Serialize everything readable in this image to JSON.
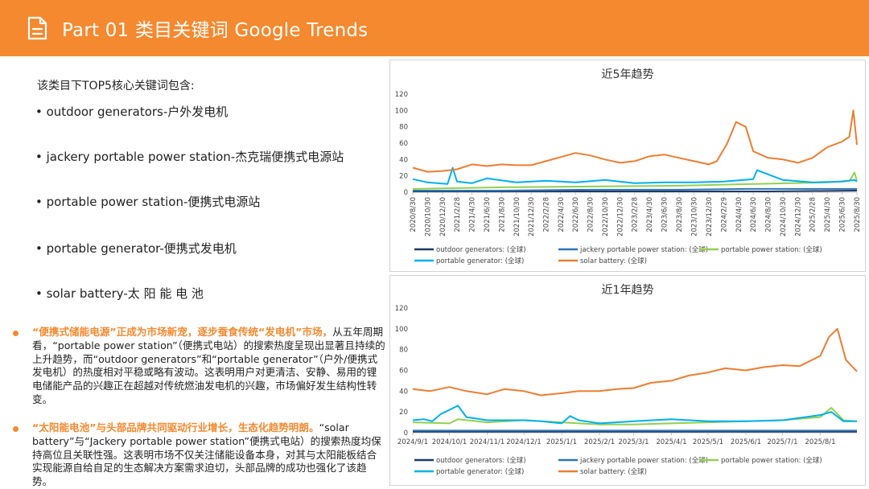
{
  "header": {
    "title": "Part 01 类目关键词 Google Trends",
    "icon": "document-icon",
    "color": "#f4892f"
  },
  "intro": "该类目下TOP5核心关键词包含:",
  "keywords": [
    "• outdoor generators-户外发电机",
    "• jackery portable power station-杰克瑞便携式电源站",
    "• portable power station-便携式电源站",
    "• portable generator-便携式发电机",
    "• solar battery-太 阳 能 电 池"
  ],
  "paragraphs": [
    {
      "highlight": "“便携式储能电源”正成为市场新宠，逐步蚕食传统“发电机”市场，",
      "text": "从五年周期看，“portable power station”（便携式电站）的搜索热度呈现出显著且持续的上升趋势，而“outdoor generators”和“portable generator”（户外/便携式发电机）的热度相对平稳或略有波动。这表明用户对更清洁、安静、易用的锂电储能产品的兴趣正在超越对传统燃油发电机的兴趣，市场偏好发生结构性转变。"
    },
    {
      "highlight": "“太阳能电池”与头部品牌共同驱动行业增长，生态化趋势明朗。",
      "text": "“solar battery”与“Jackery portable power station”便携式电站）的搜索热度均保持高位且关联性强。这表明市场不仅关注储能设备本身，对其与太阳能板结合实现能源自给自足的生态解决方案需求迫切，头部品牌的成功也强化了该趋势。"
    }
  ],
  "legend": [
    {
      "label": "outdoor generators: (全球)",
      "color": "#1f3864"
    },
    {
      "label": "jackery portable power station: (全球)",
      "color": "#2e75b6"
    },
    {
      "label": "portable power station: (全球)",
      "color": "#92d050"
    },
    {
      "label": "portable generator: (全球)",
      "color": "#00b0f0"
    },
    {
      "label": "solar battery: (全球)",
      "color": "#ed7d31"
    }
  ],
  "chart_data": [
    {
      "type": "line",
      "title": "近5年趋势",
      "ylim": [
        0,
        120
      ],
      "yticks": [
        0,
        20,
        40,
        60,
        80,
        100,
        120
      ],
      "x_start": "2020-08-30",
      "x_end": "2025-08-30",
      "xticks": [
        "2020/8/30",
        "2020/10/30",
        "2020/12/30",
        "2021/2/28",
        "2021/4/30",
        "2021/6/30",
        "2021/8/30",
        "2021/10/30",
        "2021/12/30",
        "2022/2/28",
        "2022/4/30",
        "2022/6/30",
        "2022/8/30",
        "2022/10/30",
        "2022/12/30",
        "2023/2/28",
        "2023/4/30",
        "2023/6/30",
        "2023/8/30",
        "2023/10/30",
        "2023/12/30",
        "2024/2/29",
        "2024/4/30",
        "2024/6/30",
        "2024/8/30",
        "2024/10/30",
        "2024/12/30",
        "2025/2/28",
        "2025/4/30",
        "2025/6/30",
        "2025/8/30"
      ],
      "series": [
        {
          "name": "outdoor generators: (全球)",
          "x": [
            "2020-08-30",
            "2021-08-30",
            "2022-08-30",
            "2023-08-30",
            "2024-08-30",
            "2025-08-30"
          ],
          "values": [
            1,
            1,
            1,
            1,
            1,
            2
          ]
        },
        {
          "name": "jackery portable power station: (全球)",
          "x": [
            "2020-08-30",
            "2021-08-30",
            "2022-08-30",
            "2023-08-30",
            "2024-06-01",
            "2025-08-30"
          ],
          "values": [
            2,
            2,
            3,
            3,
            4,
            4
          ]
        },
        {
          "name": "portable power station: (全球)",
          "x": [
            "2020-08-30",
            "2021-02-28",
            "2021-08-30",
            "2022-08-30",
            "2023-08-30",
            "2024-06-30",
            "2025-04-30",
            "2025-07-30",
            "2025-08-20",
            "2025-08-30"
          ],
          "values": [
            4,
            5,
            6,
            7,
            8,
            10,
            12,
            14,
            24,
            14
          ]
        },
        {
          "name": "portable generator: (全球)",
          "x": [
            "2020-08-30",
            "2020-10-30",
            "2021-01-20",
            "2021-02-10",
            "2021-02-28",
            "2021-04-30",
            "2021-07-01",
            "2021-10-30",
            "2022-02-28",
            "2022-07-01",
            "2022-10-30",
            "2023-02-28",
            "2023-07-01",
            "2023-10-30",
            "2024-02-29",
            "2024-06-30",
            "2024-07-15",
            "2024-10-30",
            "2025-02-28",
            "2025-06-30",
            "2025-08-20",
            "2025-08-30"
          ],
          "values": [
            16,
            12,
            10,
            30,
            13,
            11,
            17,
            12,
            14,
            12,
            15,
            11,
            12,
            12,
            13,
            16,
            27,
            15,
            12,
            13,
            15,
            13
          ]
        },
        {
          "name": "solar battery: (全球)",
          "x": [
            "2020-08-30",
            "2020-10-30",
            "2020-12-30",
            "2021-02-28",
            "2021-04-30",
            "2021-06-30",
            "2021-08-30",
            "2021-10-30",
            "2021-12-30",
            "2022-02-28",
            "2022-04-30",
            "2022-06-30",
            "2022-08-30",
            "2022-10-30",
            "2022-12-30",
            "2023-02-28",
            "2023-04-30",
            "2023-06-30",
            "2023-08-30",
            "2023-10-30",
            "2023-12-30",
            "2024-02-01",
            "2024-03-15",
            "2024-04-20",
            "2024-05-30",
            "2024-06-30",
            "2024-08-30",
            "2024-10-30",
            "2024-12-30",
            "2025-02-28",
            "2025-04-30",
            "2025-06-30",
            "2025-07-30",
            "2025-08-15",
            "2025-08-30"
          ],
          "values": [
            30,
            25,
            26,
            28,
            34,
            32,
            34,
            33,
            33,
            38,
            43,
            48,
            45,
            40,
            36,
            38,
            44,
            46,
            42,
            38,
            34,
            38,
            60,
            86,
            80,
            50,
            42,
            40,
            36,
            42,
            55,
            62,
            68,
            100,
            58
          ]
        }
      ]
    },
    {
      "type": "line",
      "title": "近1年趋势",
      "ylim": [
        0,
        120
      ],
      "yticks": [
        0,
        20,
        40,
        60,
        80,
        100,
        120
      ],
      "x_start": "2024-09-01",
      "x_end": "2025-08-31",
      "xticks": [
        "2024/9/1",
        "2024/10/1",
        "2024/11/1",
        "2024/12/1",
        "2025/1/1",
        "2025/2/1",
        "2025/3/1",
        "2025/4/1",
        "2025/5/1",
        "2025/6/1",
        "2025/7/1",
        "2025/8/1"
      ],
      "series": [
        {
          "name": "outdoor generators: (全球)",
          "x": [
            "2024-09-01",
            "2025-08-31"
          ],
          "values": [
            1,
            1
          ]
        },
        {
          "name": "jackery portable power station: (全球)",
          "x": [
            "2024-09-01",
            "2025-01-01",
            "2025-05-01",
            "2025-08-31"
          ],
          "values": [
            2,
            2,
            2,
            2
          ]
        },
        {
          "name": "portable power station: (全球)",
          "x": [
            "2024-09-01",
            "2024-10-01",
            "2024-10-08",
            "2024-11-01",
            "2024-12-01",
            "2025-01-01",
            "2025-02-01",
            "2025-03-01",
            "2025-04-01",
            "2025-05-01",
            "2025-06-01",
            "2025-07-01",
            "2025-08-01",
            "2025-08-10",
            "2025-08-20",
            "2025-08-31"
          ],
          "values": [
            10,
            9,
            13,
            10,
            12,
            10,
            8,
            8,
            9,
            10,
            11,
            12,
            15,
            24,
            12,
            11
          ]
        },
        {
          "name": "portable generator: (全球)",
          "x": [
            "2024-09-01",
            "2024-09-10",
            "2024-09-17",
            "2024-09-24",
            "2024-10-01",
            "2024-10-08",
            "2024-10-15",
            "2024-11-01",
            "2024-12-01",
            "2024-12-15",
            "2025-01-01",
            "2025-01-08",
            "2025-01-15",
            "2025-02-01",
            "2025-03-01",
            "2025-04-01",
            "2025-05-01",
            "2025-06-01",
            "2025-07-01",
            "2025-08-01",
            "2025-08-10",
            "2025-08-20",
            "2025-08-31"
          ],
          "values": [
            12,
            13,
            11,
            18,
            22,
            26,
            15,
            12,
            12,
            11,
            9,
            16,
            12,
            9,
            11,
            13,
            11,
            11,
            12,
            17,
            20,
            11,
            11
          ]
        },
        {
          "name": "solar battery: (全球)",
          "x": [
            "2024-09-01",
            "2024-09-15",
            "2024-10-01",
            "2024-10-15",
            "2024-11-01",
            "2024-11-15",
            "2024-12-01",
            "2024-12-15",
            "2025-01-01",
            "2025-01-15",
            "2025-02-01",
            "2025-02-15",
            "2025-03-01",
            "2025-03-15",
            "2025-04-01",
            "2025-04-15",
            "2025-05-01",
            "2025-05-15",
            "2025-06-01",
            "2025-06-15",
            "2025-07-01",
            "2025-07-15",
            "2025-08-01",
            "2025-08-08",
            "2025-08-15",
            "2025-08-22",
            "2025-08-31"
          ],
          "values": [
            42,
            40,
            44,
            40,
            37,
            42,
            40,
            36,
            38,
            40,
            40,
            42,
            43,
            48,
            50,
            55,
            58,
            62,
            60,
            63,
            65,
            64,
            74,
            92,
            100,
            70,
            59
          ]
        }
      ]
    }
  ]
}
